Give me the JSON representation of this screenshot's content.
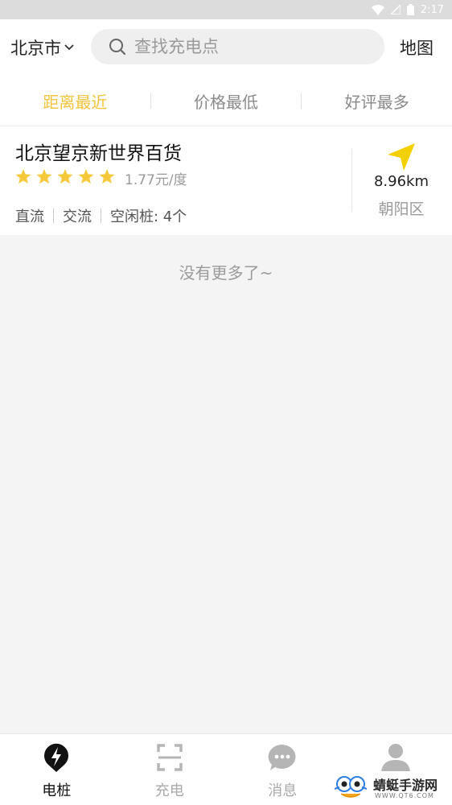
{
  "status_bar": {
    "time": "2:17"
  },
  "header": {
    "city": "北京市",
    "search_placeholder": "查找充电点",
    "map_label": "地图"
  },
  "sort_tabs": [
    {
      "label": "距离最近",
      "active": true
    },
    {
      "label": "价格最低",
      "active": false
    },
    {
      "label": "好评最多",
      "active": false
    }
  ],
  "stations": [
    {
      "name": "北京望京新世界百货",
      "rating": 5,
      "price": "1.77元/度",
      "tags": [
        "直流",
        "交流",
        "空闲桩: 4个"
      ],
      "distance": "8.96km",
      "district": "朝阳区"
    }
  ],
  "list_footer": "没有更多了~",
  "bottom_nav": [
    {
      "label": "电桩",
      "icon": "lightning-pin-icon",
      "active": true
    },
    {
      "label": "充电",
      "icon": "scan-icon",
      "active": false
    },
    {
      "label": "消息",
      "icon": "chat-bubble-icon",
      "active": false
    },
    {
      "label": "",
      "icon": "user-icon",
      "active": false
    }
  ],
  "watermark": {
    "text": "蜻蜓手游网",
    "sub": "WWW.QT6.COM"
  },
  "colors": {
    "accent": "#f3c33d",
    "star": "#f6c93b",
    "arrow": "#f5d000"
  }
}
